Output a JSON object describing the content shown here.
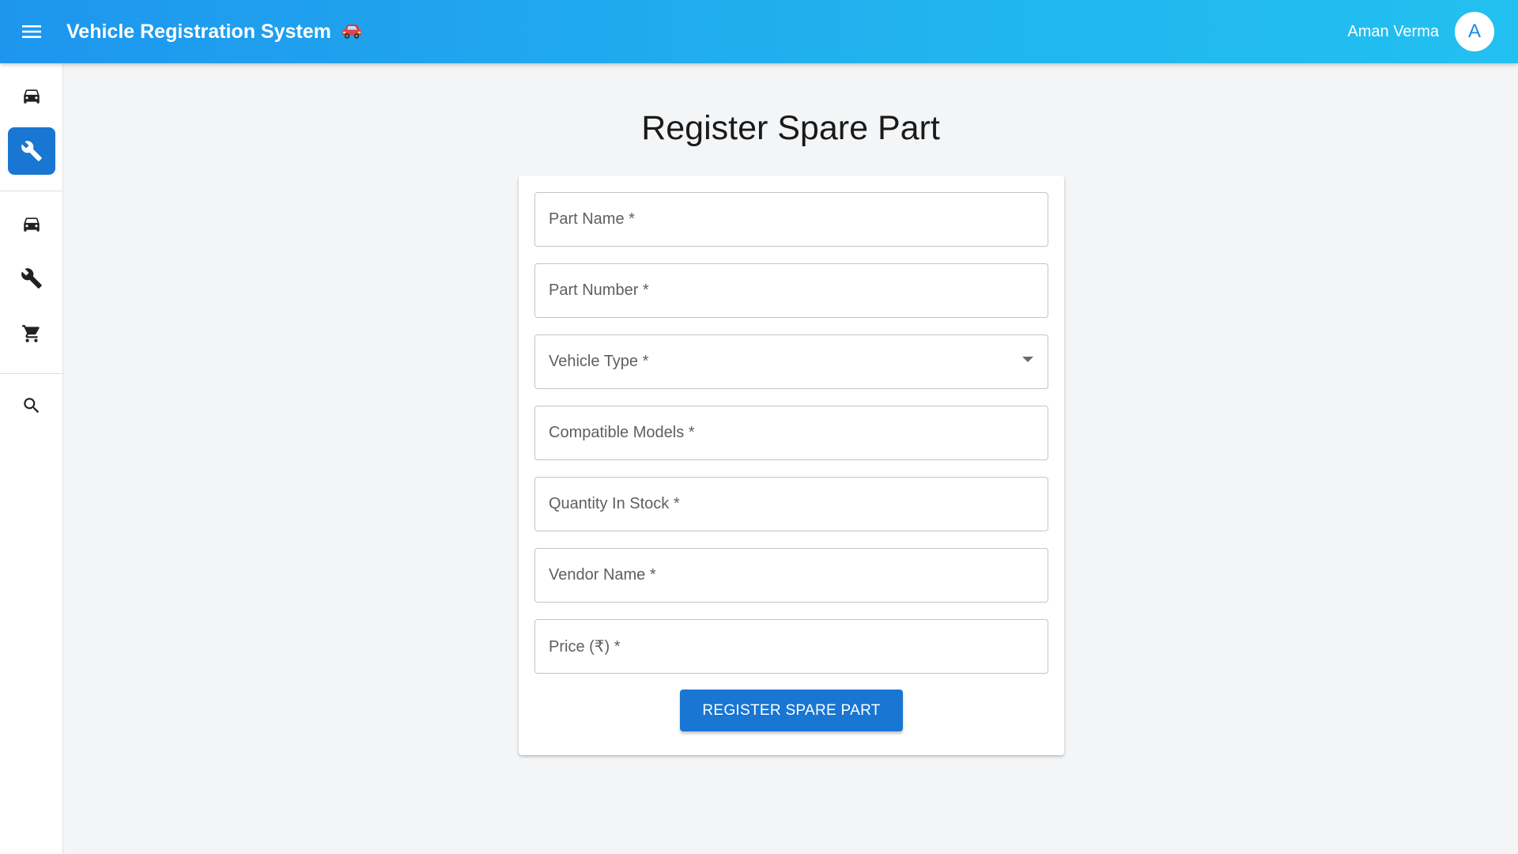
{
  "header": {
    "title": "Vehicle Registration System",
    "title_emoji_icon": "red-car-icon",
    "menu_icon": "hamburger-menu-icon",
    "user_name": "Aman Verma",
    "avatar_letter": "A",
    "accent_start": "#1e96ee",
    "accent_end": "#22c0f0"
  },
  "sidebar": {
    "items": [
      {
        "icon": "car-icon",
        "active": false
      },
      {
        "icon": "wrench-icon",
        "active": true
      },
      {
        "icon": "car-icon",
        "active": false
      },
      {
        "icon": "wrench-icon",
        "active": false
      },
      {
        "icon": "shopping-cart-icon",
        "active": false
      },
      {
        "icon": "search-icon",
        "active": false
      }
    ],
    "active_color": "#1976d2"
  },
  "main": {
    "title": "Register Spare Part",
    "form": {
      "fields": [
        {
          "label": "Part Name *",
          "value": "",
          "type": "text"
        },
        {
          "label": "Part Number *",
          "value": "",
          "type": "text"
        },
        {
          "label": "Vehicle Type *",
          "value": "",
          "type": "select"
        },
        {
          "label": "Compatible Models *",
          "value": "",
          "type": "text"
        },
        {
          "label": "Quantity In Stock *",
          "value": "",
          "type": "text"
        },
        {
          "label": "Vendor Name *",
          "value": "",
          "type": "text"
        },
        {
          "label": "Price (₹) *",
          "value": "",
          "type": "text"
        }
      ],
      "submit_label": "REGISTER SPARE PART",
      "submit_color": "#1976d2"
    }
  }
}
